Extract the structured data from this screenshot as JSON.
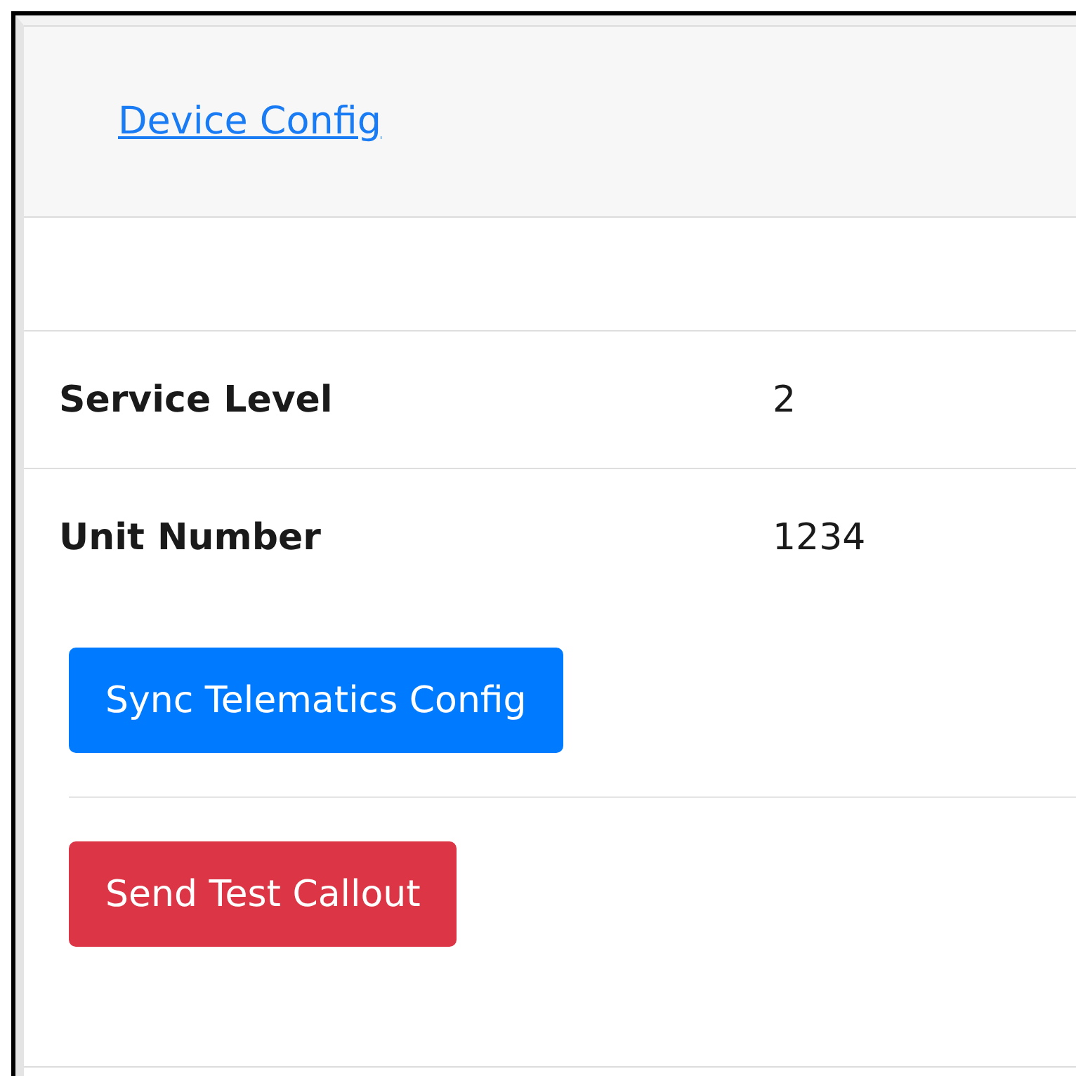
{
  "header": {
    "link": "Device Config"
  },
  "fields": [
    {
      "label": "Service Level",
      "value": "2"
    },
    {
      "label": "Unit Number",
      "value": "1234"
    }
  ],
  "buttons": [
    {
      "label": "Sync Telematics Config",
      "kind": "primary"
    },
    {
      "label": "Send Test Callout",
      "kind": "danger"
    }
  ]
}
